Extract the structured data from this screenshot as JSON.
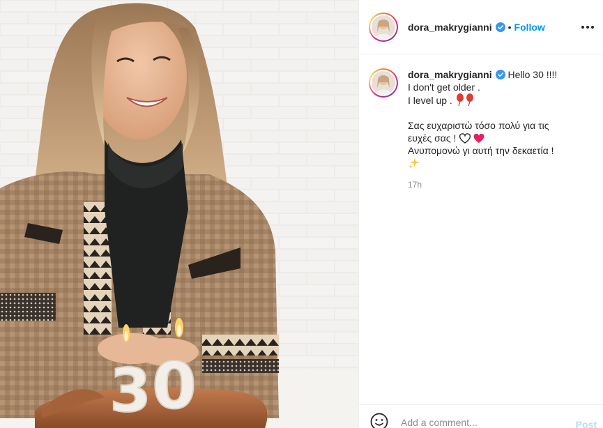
{
  "post": {
    "username": "dora_makrygianni",
    "separator": "•",
    "follow_label": "Follow",
    "more_icon": "more-horizontal-icon",
    "verified_icon": "verified-badge-icon",
    "verified_color": "#3897f0",
    "accent_color": "#0095f6"
  },
  "caption": {
    "username": "dora_makrygianni",
    "lines": [
      " Hello 30 !!!!",
      "I don't get older .",
      "I level up . ",
      "",
      "Σας ευχαριστώ τόσο πολύ για τις",
      "ευχές σας ! ",
      "Ανυπομονώ γι αυτή την δεκαετία !",
      ""
    ],
    "emoji": {
      "balloons": "balloon-icon",
      "hearts": [
        "white-heart-icon",
        "red-heart-icon"
      ],
      "sparkles": "sparkles-icon"
    },
    "timestamp": "17h"
  },
  "comment": {
    "emoji_icon": "smiley-icon",
    "placeholder": "Add a comment...",
    "post_label": "Post"
  },
  "photo": {
    "name": "birthday-photo",
    "cake_number": "30"
  }
}
